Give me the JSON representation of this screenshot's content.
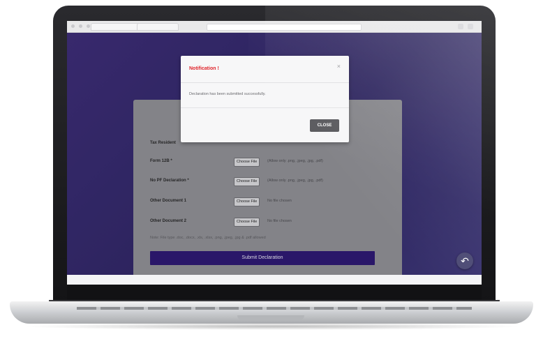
{
  "browser": {
    "tab_label": "",
    "address": ""
  },
  "form": {
    "rows": [
      {
        "label": "Tax Resident",
        "button": "",
        "file": ""
      },
      {
        "label": "Form 12B *",
        "button": "Choose File",
        "file": "(Allow only .png, .jpeg, .jpg, .pdf)"
      },
      {
        "label": "No PF Declaration *",
        "button": "Choose File",
        "file": "(Allow only .png, .jpeg, .jpg, .pdf)"
      },
      {
        "label": "Other Document 1",
        "button": "Choose File",
        "file": "No file chosen"
      },
      {
        "label": "Other Document 2",
        "button": "Choose File",
        "file": "No file chosen"
      }
    ],
    "hint": "Note: File type .doc, .docx, .xls, .xlsx, .png, .jpeg, .jpg & .pdf allowed",
    "submit_label": "Submit Declaration"
  },
  "modal": {
    "title": "Notification !",
    "close_symbol": "×",
    "message": "Declaration has been submitted successfully.",
    "button_label": "CLOSE"
  },
  "fab": {
    "symbol": "↶"
  },
  "colors": {
    "page_bg": "#2c2362",
    "submit_bg": "#2b1670",
    "modal_title": "#e0242b",
    "close_btn": "#5a5a5e"
  }
}
